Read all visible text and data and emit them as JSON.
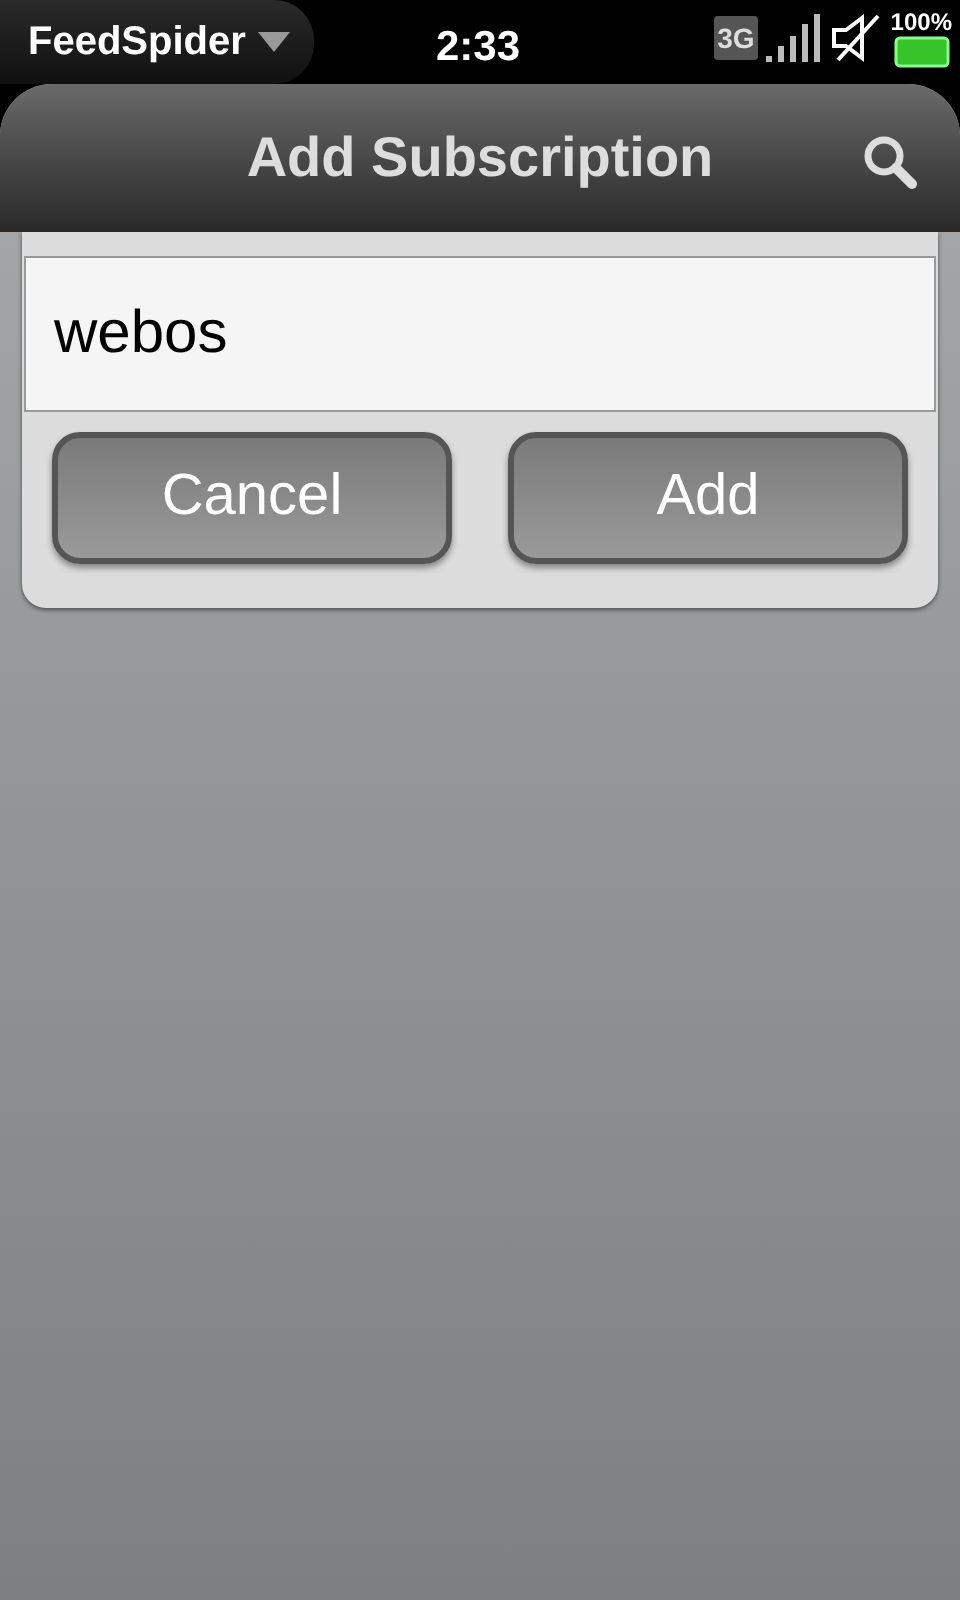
{
  "status_bar": {
    "app_menu": "FeedSpider",
    "time": "2:33",
    "network": "3G",
    "battery": "100%"
  },
  "header": {
    "title": "Add Subscription"
  },
  "dialog": {
    "input": {
      "value": "webos"
    },
    "buttons": [
      {
        "label": "Cancel"
      },
      {
        "label": "Add"
      }
    ]
  }
}
